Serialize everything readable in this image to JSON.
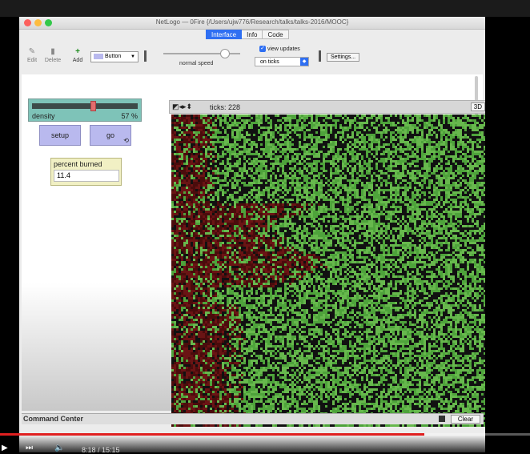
{
  "window": {
    "title": "NetLogo — 0Fire {/Users/ujw776/Research/talks/talks-2016/MOOC}"
  },
  "tabs": [
    {
      "label": "Interface",
      "active": true
    },
    {
      "label": "Info"
    },
    {
      "label": "Code"
    }
  ],
  "toolbar": {
    "edit_label": "Edit",
    "delete_label": "Delete",
    "add_label": "Add",
    "widget_select": "Button",
    "speed_label": "normal speed",
    "view_updates_label": "view updates",
    "view_updates_checked": true,
    "update_mode": "on ticks",
    "settings_label": "Settings..."
  },
  "widgets": {
    "density": {
      "label": "density",
      "value": "57 %",
      "level": 0.57
    },
    "setup_label": "setup",
    "go_label": "go",
    "monitor": {
      "label": "percent burned",
      "value": "11.4"
    }
  },
  "view": {
    "ticks_text": "ticks: 228",
    "threed_label": "3D"
  },
  "command_center": {
    "title": "Command Center",
    "clear_label": "Clear"
  },
  "video": {
    "time": "8:18 / 15:15",
    "progress": 0.8
  }
}
